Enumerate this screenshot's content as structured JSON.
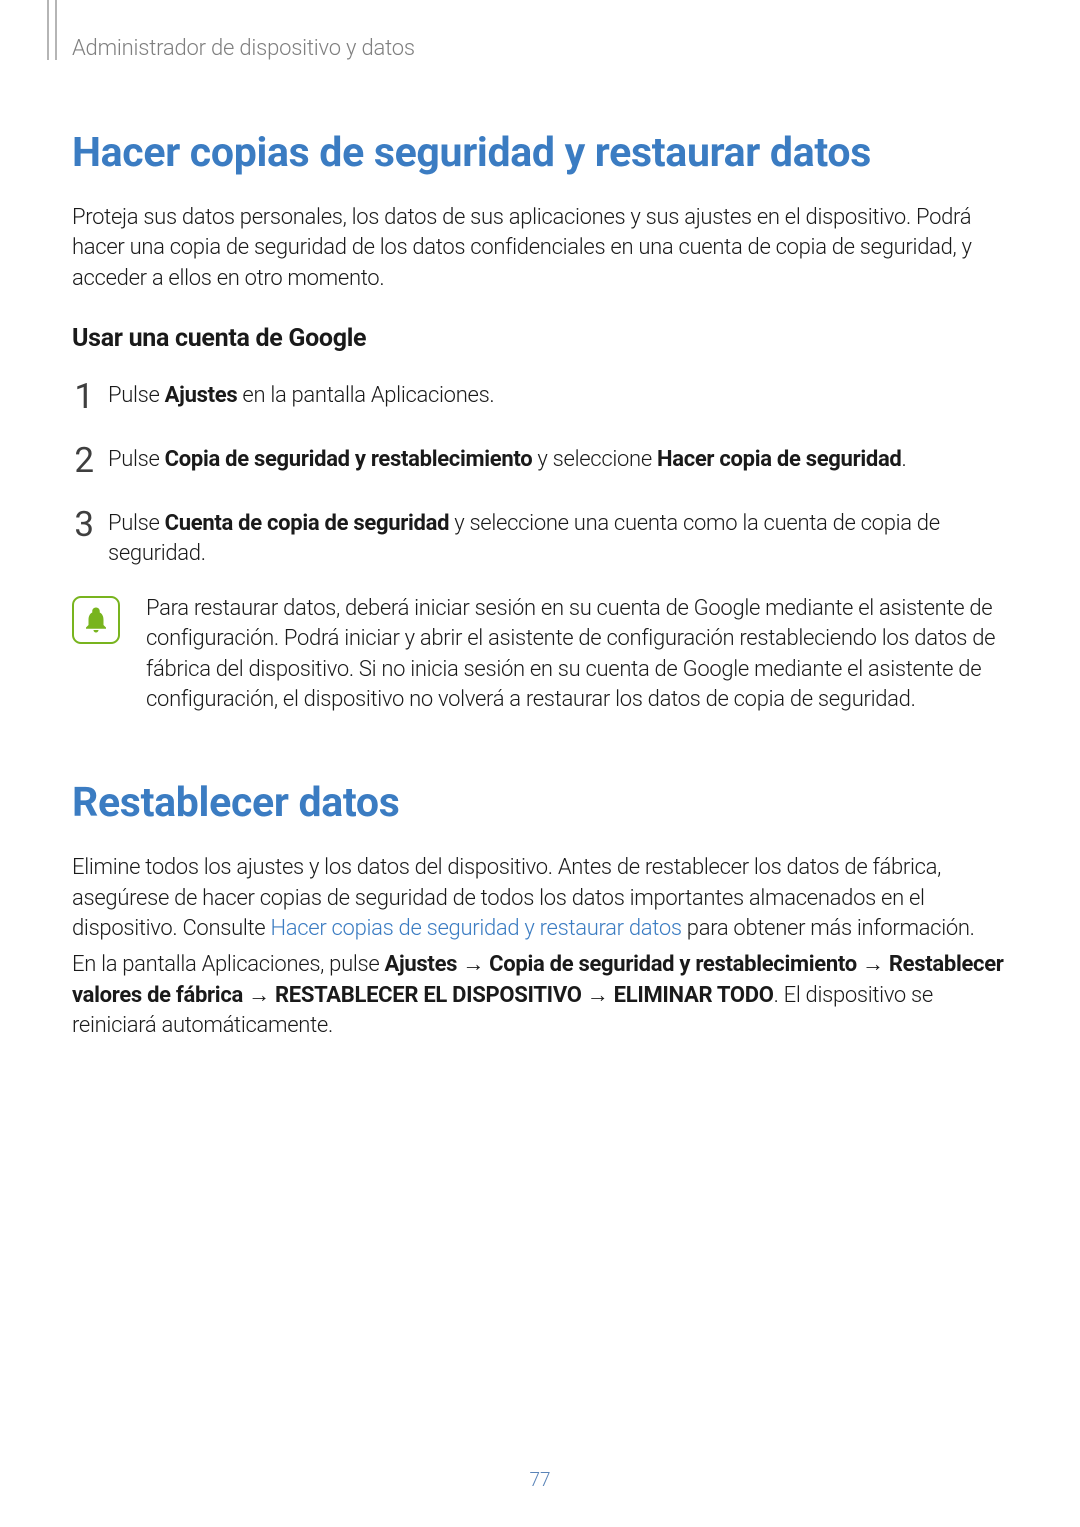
{
  "breadcrumb": "Administrador de dispositivo y datos",
  "section1": {
    "heading": "Hacer copias de seguridad y restaurar datos",
    "intro": "Proteja sus datos personales, los datos de sus aplicaciones y sus ajustes en el dispositivo. Podrá hacer una copia de seguridad de los datos confidenciales en una cuenta de copia de seguridad, y acceder a ellos en otro momento.",
    "subheading": "Usar una cuenta de Google",
    "steps": {
      "s1_pre": "Pulse ",
      "s1_b1": "Ajustes",
      "s1_post": " en la pantalla Aplicaciones.",
      "s2_pre": "Pulse ",
      "s2_b1": "Copia de seguridad y restablecimiento",
      "s2_mid": " y seleccione ",
      "s2_b2": "Hacer copia de seguridad",
      "s2_end": ".",
      "s3_pre": "Pulse ",
      "s3_b1": "Cuenta de copia de seguridad",
      "s3_post": " y seleccione una cuenta como la cuenta de copia de seguridad."
    },
    "note": "Para restaurar datos, deberá iniciar sesión en su cuenta de Google mediante el asistente de configuración. Podrá iniciar y abrir el asistente de configuración restableciendo los datos de fábrica del dispositivo. Si no inicia sesión en su cuenta de Google mediante el asistente de configuración, el dispositivo no volverá a restaurar los datos de copia de seguridad."
  },
  "section2": {
    "heading": "Restablecer datos",
    "p1_pre": "Elimine todos los ajustes y los datos del dispositivo. Antes de restablecer los datos de fábrica, asegúrese de hacer copias de seguridad de todos los datos importantes almacenados en el dispositivo. Consulte ",
    "p1_link": "Hacer copias de seguridad y restaurar datos",
    "p1_post": " para obtener más información.",
    "p2_parts": {
      "t1": "En la pantalla Aplicaciones, pulse ",
      "b1": "Ajustes",
      "arrow": " → ",
      "b2": "Copia de seguridad y restablecimiento",
      "b3": "Restablecer valores de fábrica",
      "b4": "RESTABLECER EL DISPOSITIVO",
      "b5": "ELIMINAR TODO",
      "t_end": ". El dispositivo se reiniciará automáticamente."
    }
  },
  "page_number": "77"
}
